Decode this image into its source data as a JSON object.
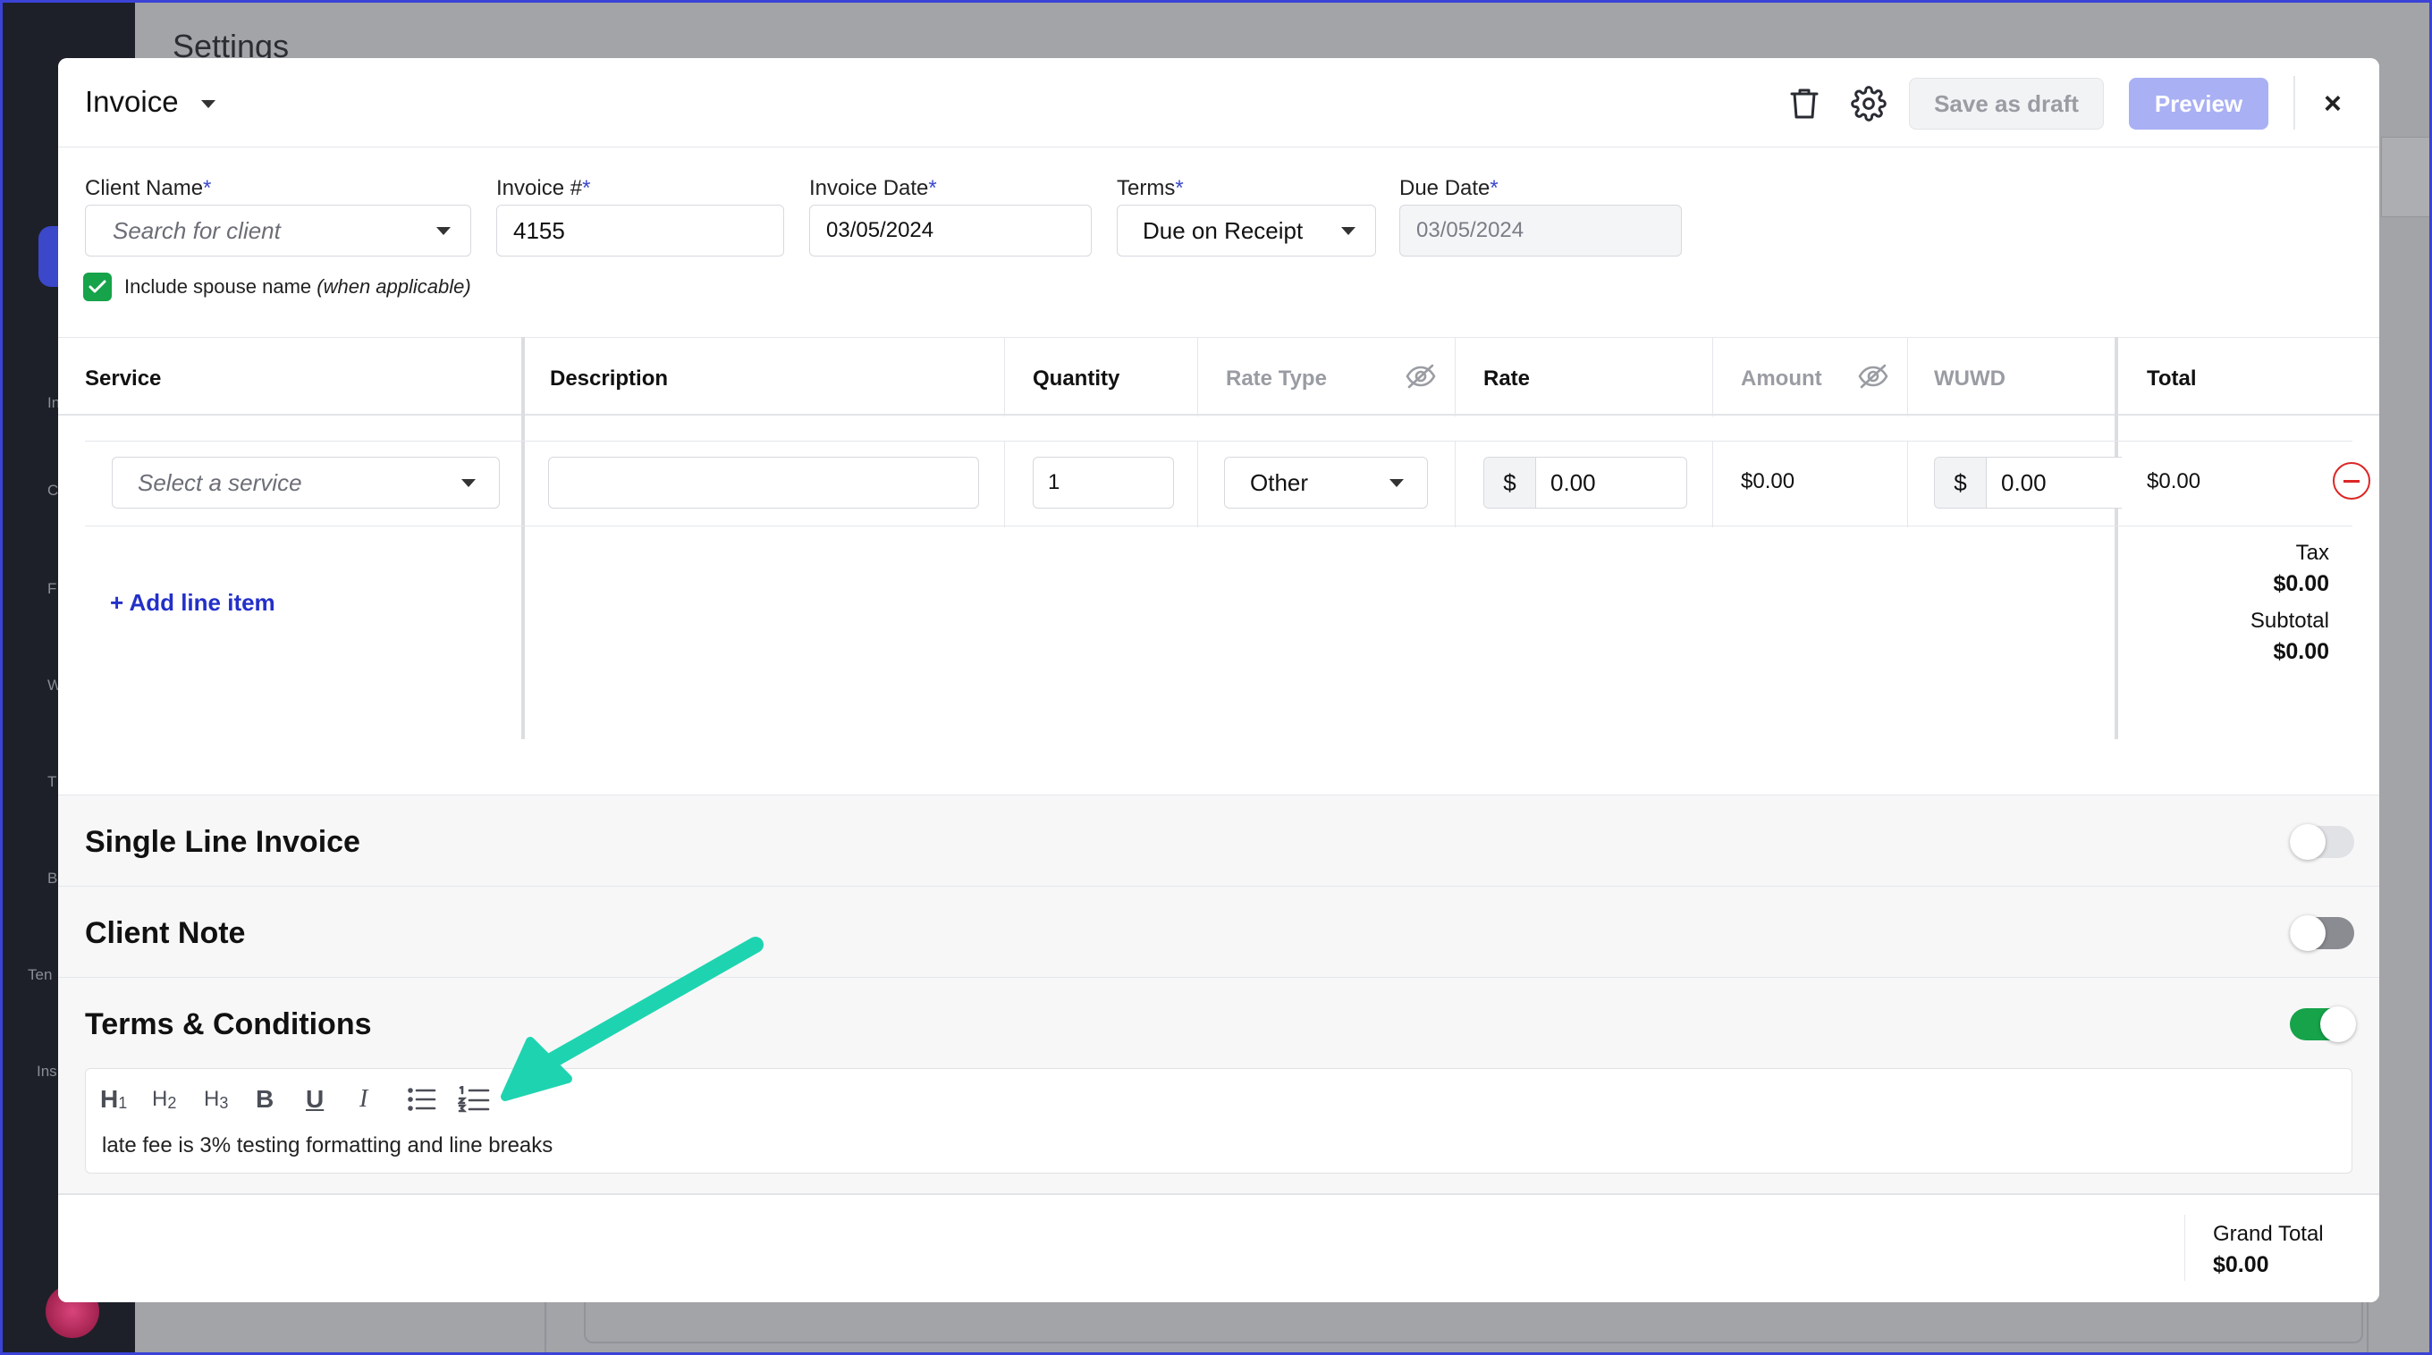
{
  "background": {
    "page_title": "Settings",
    "sidebar_labels": [
      "In",
      "Cl",
      "F",
      "W",
      "T",
      "B",
      "Ten",
      "Ins"
    ]
  },
  "modal": {
    "title": "Invoice",
    "save_draft_label": "Save as draft",
    "preview_label": "Preview",
    "close_label": "×"
  },
  "form": {
    "client_name": {
      "label": "Client Name",
      "required": "*",
      "placeholder": "Search for client"
    },
    "invoice_number": {
      "label": "Invoice #",
      "required": "*",
      "value": "4155"
    },
    "invoice_date": {
      "label": "Invoice Date",
      "required": "*",
      "value": "03/05/2024"
    },
    "terms": {
      "label": "Terms",
      "required": "*",
      "value": "Due on Receipt"
    },
    "due_date": {
      "label": "Due Date",
      "required": "*",
      "value": "03/05/2024"
    },
    "include_spouse": {
      "label": "Include spouse name",
      "hint": "(when applicable)",
      "checked": true
    }
  },
  "table": {
    "columns": {
      "service": "Service",
      "description": "Description",
      "quantity": "Quantity",
      "rate_type": "Rate Type",
      "rate": "Rate",
      "amount": "Amount",
      "wuwd": "WUWD",
      "total": "Total"
    },
    "row": {
      "service_placeholder": "Select a service",
      "description": "",
      "quantity": "1",
      "rate_type": "Other",
      "currency": "$",
      "rate": "0.00",
      "amount": "$0.00",
      "wuwd": "0.00",
      "total": "$0.00"
    },
    "add_line_label": "+ Add line item",
    "tax_label": "Tax",
    "tax_value": "$0.00",
    "subtotal_label": "Subtotal",
    "subtotal_value": "$0.00"
  },
  "sections": {
    "single_line": {
      "title": "Single Line Invoice",
      "enabled": false
    },
    "client_note": {
      "title": "Client Note",
      "enabled": false
    },
    "terms_conditions": {
      "title": "Terms & Conditions",
      "enabled": true
    }
  },
  "editor": {
    "toolbar": {
      "h1": "H",
      "h1_sub": "1",
      "h2": "H",
      "h2_sub": "2",
      "h3": "H",
      "h3_sub": "3",
      "bold": "B",
      "underline": "U",
      "italic": "I"
    },
    "content": "late fee is 3% testing formatting and line breaks"
  },
  "footer": {
    "grand_total_label": "Grand Total",
    "grand_total_value": "$0.00"
  },
  "colors": {
    "accent": "#3b48c9",
    "link": "#2330c9",
    "success": "#16a34a",
    "danger": "#dc2626",
    "annotation_arrow": "#2ad9b8"
  }
}
